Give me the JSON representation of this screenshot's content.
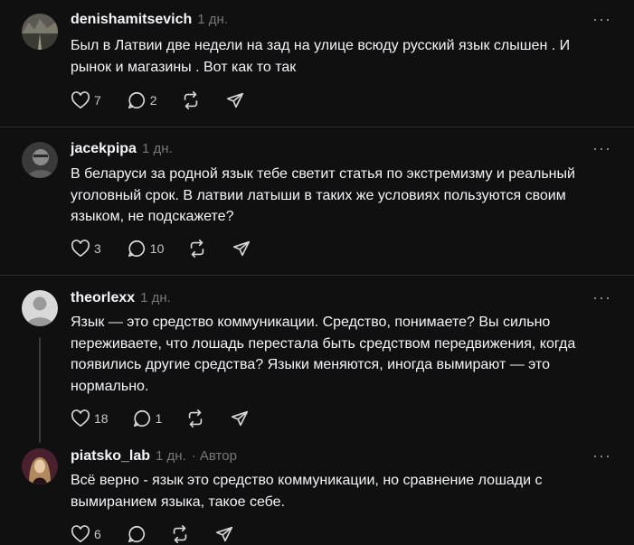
{
  "comments": [
    {
      "username": "denishamitsevich",
      "time": "1 дн.",
      "author_label": "",
      "text": "Был в Латвии две недели на зад на улице всюду русский язык слышен . И рынок и магазины . Вот как то так",
      "likes": "7",
      "replies": "2",
      "avatar_icon": "avatar-photo-landscape"
    },
    {
      "username": "jacekpipa",
      "time": "1 дн.",
      "author_label": "",
      "text": "В беларуси за родной язык тебе светит статья по экстремизму и реальный уголовный срок. В латвии латыши в таких же условиях пользуются своим языком, не подскажете?",
      "likes": "3",
      "replies": "10",
      "avatar_icon": "avatar-photo-person"
    },
    {
      "username": "theorlexx",
      "time": "1 дн.",
      "author_label": "",
      "text": "Язык — это средство коммуникации. Средство, понимаете? Вы сильно переживаете, что лошадь перестала быть средством передвижения, когда появились другие средства? Языки меняются, иногда вымирают — это нормально.",
      "likes": "18",
      "replies": "1",
      "avatar_icon": "default-avatar-icon"
    },
    {
      "username": "piatsko_lab",
      "time": "1 дн.",
      "author_label": "· Автор",
      "text": "Всё верно - язык это средство коммуникации, но сравнение лошади с вымиранием языка, такое себе.",
      "likes": "6",
      "replies": "",
      "avatar_icon": "avatar-photo-woman"
    }
  ],
  "icons": {
    "like": "heart-icon",
    "reply": "speech-bubble-icon",
    "repost": "repost-icon",
    "share": "send-icon",
    "more": "more-dots-icon"
  },
  "colors": {
    "background": "#101010",
    "text": "#f3f5f7",
    "muted": "#777777",
    "divider": "#2d2d2d"
  }
}
